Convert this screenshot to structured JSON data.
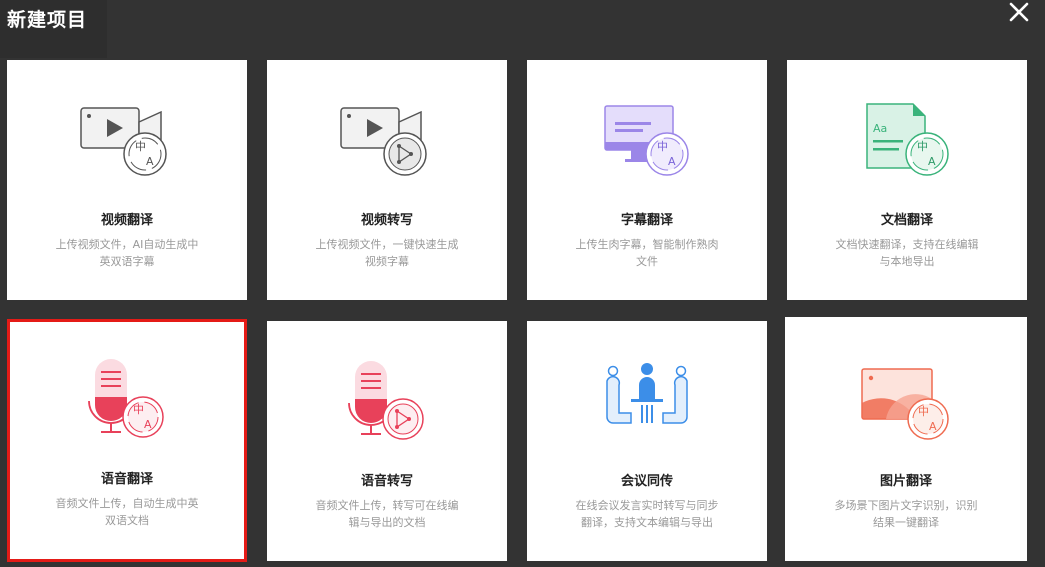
{
  "modal": {
    "title": "新建项目"
  },
  "cards": [
    {
      "title": "视频翻译",
      "desc": "上传视频文件，AI自动生成中英双语字幕",
      "icon": "video-translate-icon"
    },
    {
      "title": "视频转写",
      "desc": "上传视频文件，一键快速生成视频字幕",
      "icon": "video-transcribe-icon"
    },
    {
      "title": "字幕翻译",
      "desc": "上传生肉字幕，智能制作熟肉文件",
      "icon": "subtitle-translate-icon"
    },
    {
      "title": "文档翻译",
      "desc": "文档快速翻译，支持在线编辑与本地导出",
      "icon": "document-translate-icon"
    },
    {
      "title": "语音翻译",
      "desc": "音频文件上传，自动生成中英双语文档",
      "icon": "audio-translate-icon"
    },
    {
      "title": "语音转写",
      "desc": "音频文件上传，转写可在线编辑与导出的文档",
      "icon": "audio-transcribe-icon"
    },
    {
      "title": "会议同传",
      "desc": "在线会议发言实时转写与同步翻译，支持文本编辑与导出",
      "icon": "meeting-interpret-icon"
    },
    {
      "title": "图片翻译",
      "desc": "多场景下图片文字识别，识别结果一键翻译",
      "icon": "image-translate-icon"
    }
  ],
  "icon_text": {
    "zh": "中",
    "a": "A",
    "aa": "Aa"
  },
  "colors": {
    "background": "#333333",
    "card": "#ffffff",
    "selected_border": "#e41b17",
    "purple": "#9b86e8",
    "green": "#3ab37b",
    "red": "#e8415a",
    "blue": "#3c8ee8",
    "orange": "#ef6b50"
  }
}
